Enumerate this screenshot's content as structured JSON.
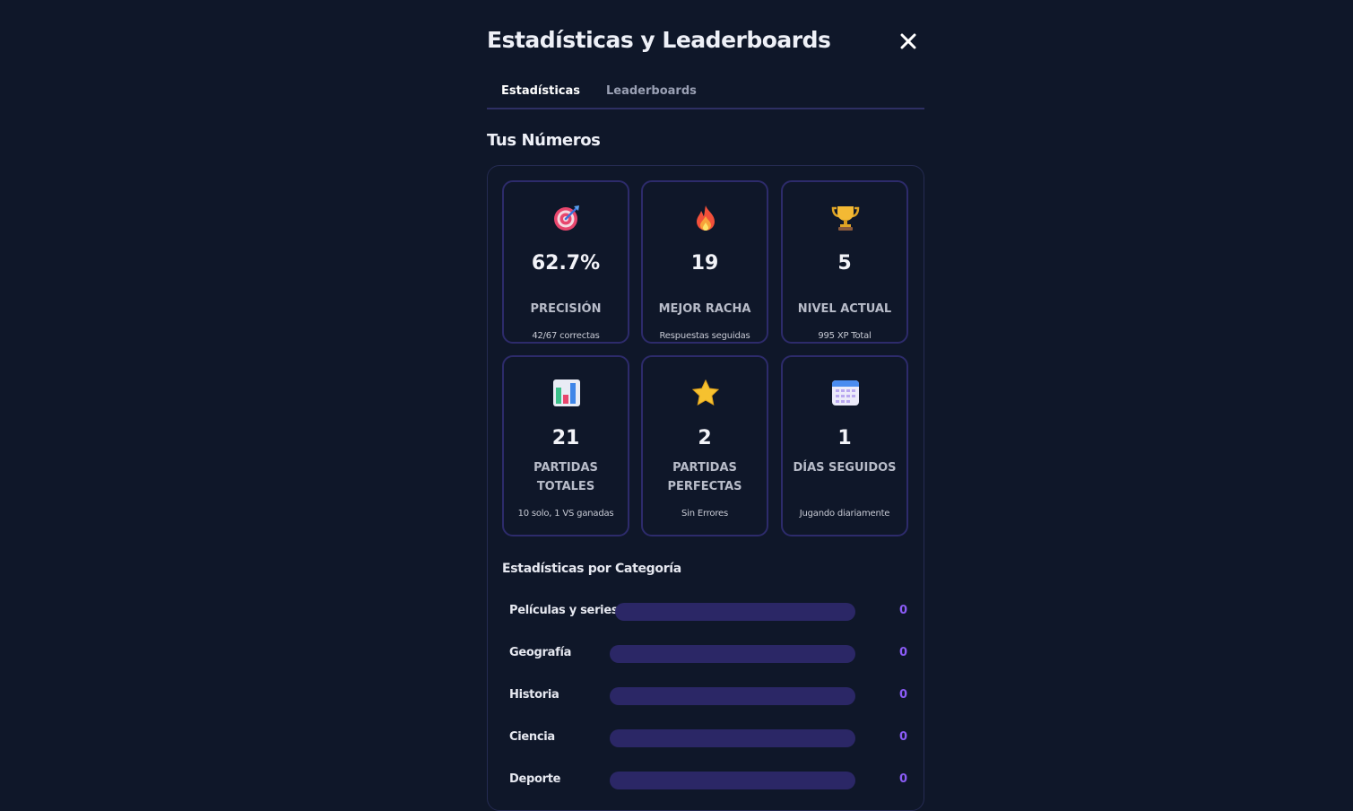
{
  "modal": {
    "title": "Estadísticas y Leaderboards",
    "close_icon": "close-icon"
  },
  "tabs": [
    {
      "label": "Estadísticas",
      "active": true
    },
    {
      "label": "Leaderboards",
      "active": false
    }
  ],
  "section_title": "Tus Números",
  "stats": [
    {
      "icon": "target-icon",
      "value": "62.7%",
      "label": "PRECISIÓN",
      "sub": "42/67 correctas"
    },
    {
      "icon": "fire-icon",
      "value": "19",
      "label": "MEJOR RACHA",
      "sub": "Respuestas seguidas"
    },
    {
      "icon": "trophy-icon",
      "value": "5",
      "label": "NIVEL ACTUAL",
      "sub": "995 XP Total"
    },
    {
      "icon": "bar-chart-icon",
      "value": "21",
      "label": "PARTIDAS TOTALES",
      "sub": "10 solo, 1 VS ganadas"
    },
    {
      "icon": "star-icon",
      "value": "2",
      "label": "PARTIDAS PERFECTAS",
      "sub": "Sin Errores"
    },
    {
      "icon": "calendar-icon",
      "value": "1",
      "label": "DÍAS SEGUIDOS",
      "sub": "Jugando diariamente"
    }
  ],
  "categories_title": "Estadísticas por Categoría",
  "categories": [
    {
      "name": "Películas y series",
      "count": "0",
      "progress": 0
    },
    {
      "name": "Geografía",
      "count": "0",
      "progress": 0
    },
    {
      "name": "Historia",
      "count": "0",
      "progress": 0
    },
    {
      "name": "Ciencia",
      "count": "0",
      "progress": 0
    },
    {
      "name": "Deporte",
      "count": "0",
      "progress": 0
    }
  ],
  "colors": {
    "background": "#0f1729",
    "card_border": "#2d2b6b",
    "bar_track": "#2b2766",
    "accent": "#8b5cf6"
  }
}
